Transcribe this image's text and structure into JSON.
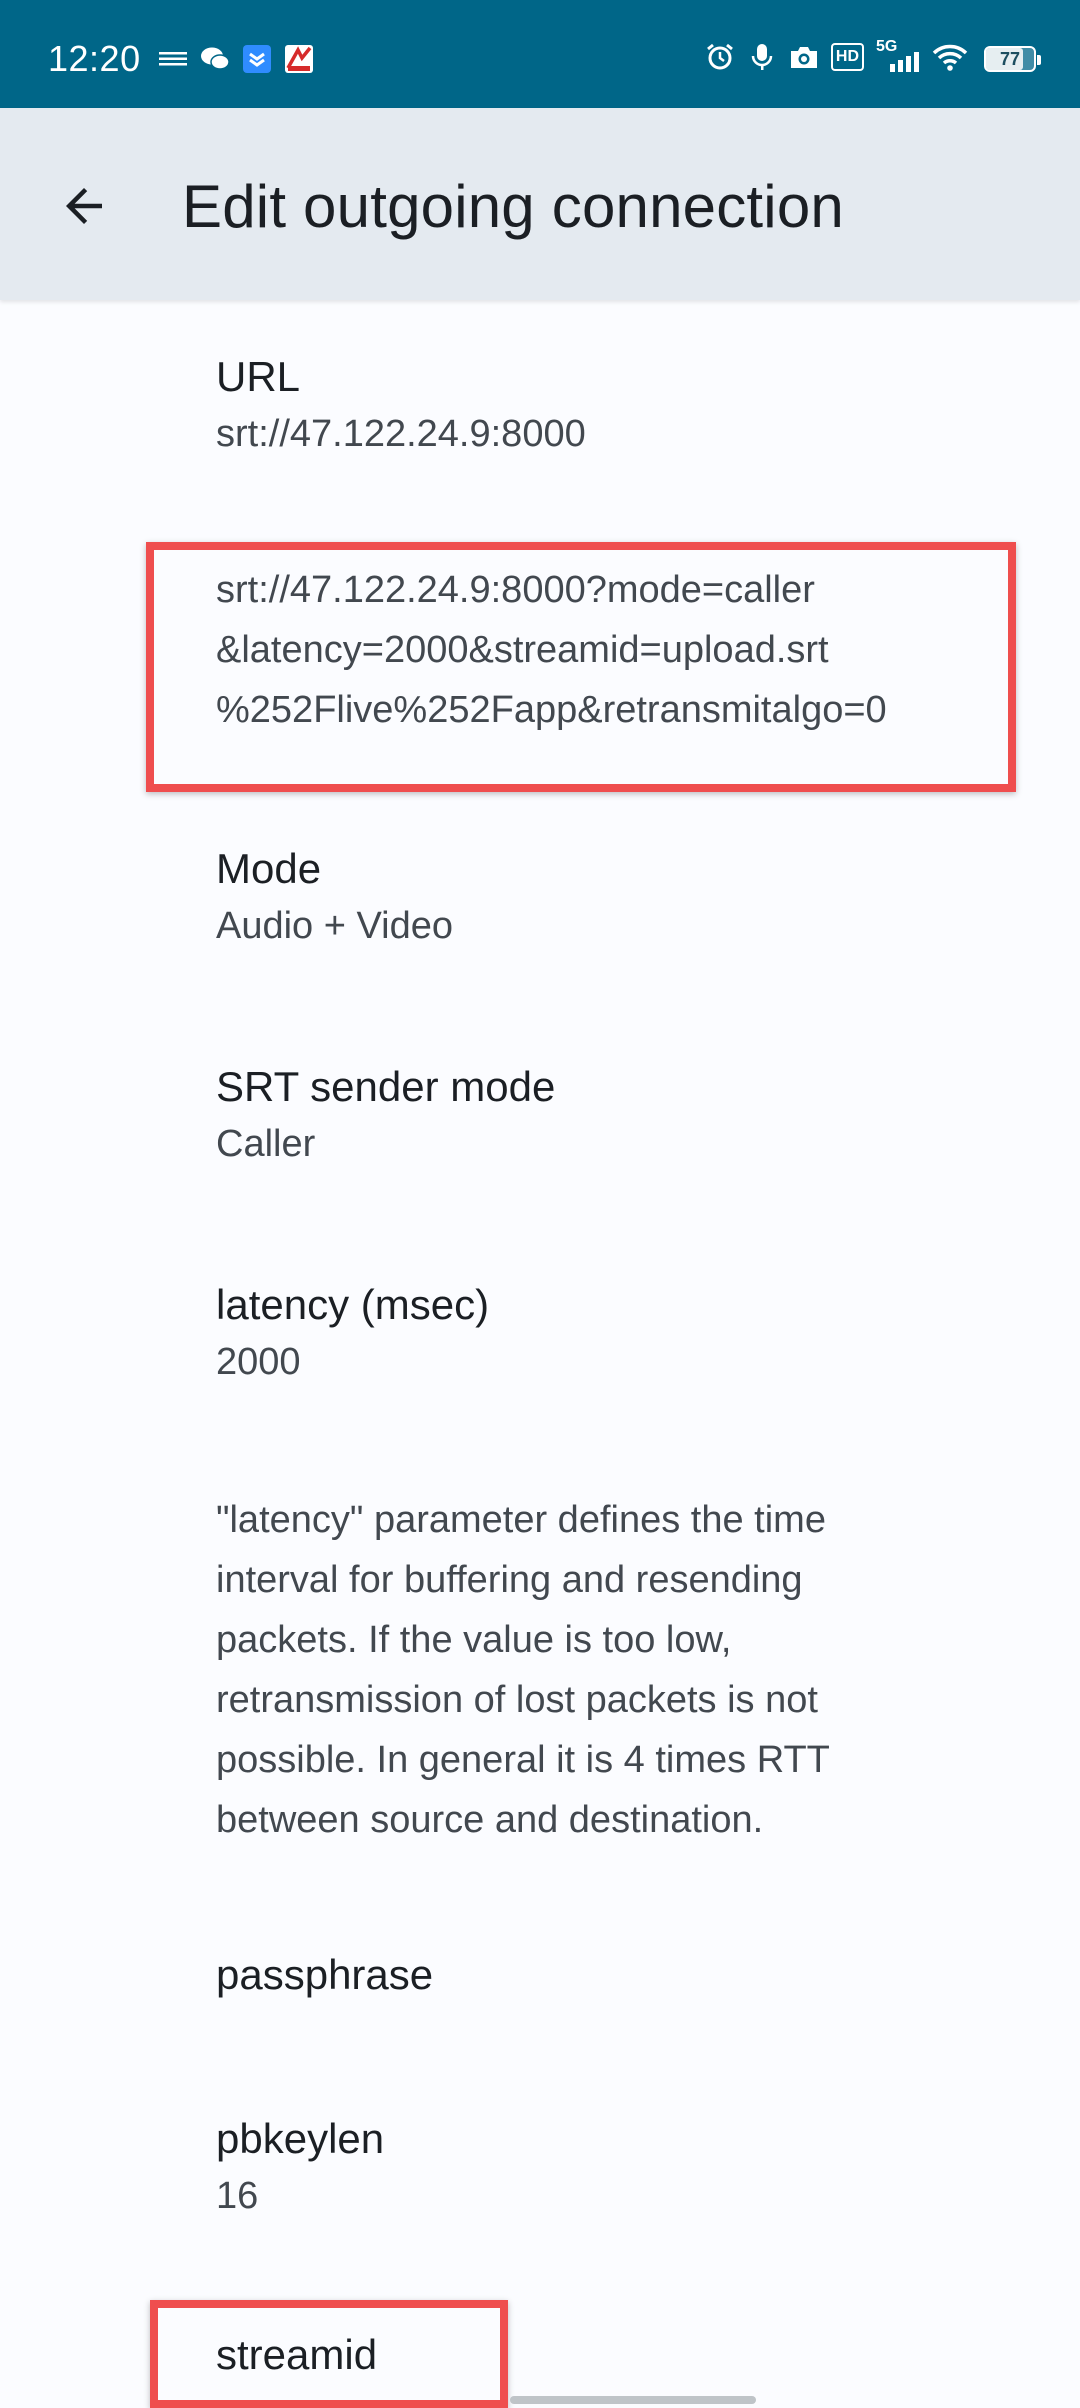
{
  "status_bar": {
    "time": "12:20",
    "left_icons": [
      "notification-icon",
      "wechat-icon",
      "app-icon",
      "app-icon-2"
    ],
    "right_icons": [
      "alarm-icon",
      "mic-icon",
      "camera-icon",
      "hd-icon",
      "signal-5g-icon",
      "wifi-icon"
    ],
    "hd_label": "HD",
    "network_label": "5G",
    "battery": "77",
    "battery_level_fraction": 0.77
  },
  "app_bar": {
    "title": "Edit outgoing connection"
  },
  "prefs": {
    "url": {
      "title": "URL",
      "summary": "srt://47.122.24.9:8000"
    },
    "full_url": {
      "line1": "srt://47.122.24.9:8000?mode=caller",
      "line2": "&latency=2000&streamid=upload.srt",
      "line3": "%252Flive%252Fapp&retransmitalgo=0"
    },
    "mode": {
      "title": "Mode",
      "summary": "Audio + Video"
    },
    "sender_mode": {
      "title": "SRT sender mode",
      "summary": "Caller"
    },
    "latency": {
      "title": "latency (msec)",
      "summary": "2000"
    },
    "latency_info": {
      "line1": "\"latency\" parameter defines the time",
      "line2": "interval for buffering and resending",
      "line3": "packets. If the value is too low,",
      "line4": "retransmission of lost packets is not",
      "line5": "possible. In general it is 4 times RTT",
      "line6": "between source and destination."
    },
    "passphrase": {
      "title": "passphrase"
    },
    "pbkeylen": {
      "title": "pbkeylen",
      "summary": "16"
    },
    "streamid": {
      "title": "streamid"
    }
  },
  "colors": {
    "status_bar": "#006688",
    "app_bar": "#e4eaf0",
    "highlight": "#ef4e4e",
    "background": "#fbfcff"
  }
}
